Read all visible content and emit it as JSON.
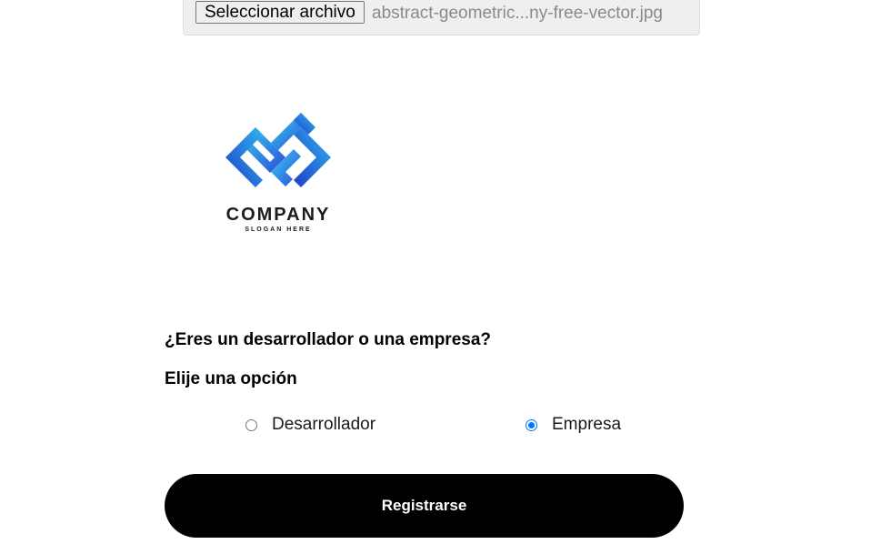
{
  "file_input": {
    "button_label": "Seleccionar archivo",
    "file_name": "abstract-geometric...ny-free-vector.jpg"
  },
  "logo": {
    "company": "COMPANY",
    "slogan": "SLOGAN HERE",
    "icon": "geometric-logo-icon",
    "colors": {
      "gradient_start": "#3ad1f0",
      "gradient_end": "#2a4bd8"
    }
  },
  "form": {
    "question": "¿Eres un desarrollador o una empresa?",
    "subtitle": "Elije una opción",
    "options": [
      {
        "label": "Desarrollador",
        "checked": false
      },
      {
        "label": "Empresa",
        "checked": true
      }
    ],
    "submit_label": "Registrarse"
  },
  "colors": {
    "radio_accent": "#0075ff",
    "button_bg": "#000000",
    "button_text": "#ffffff"
  }
}
